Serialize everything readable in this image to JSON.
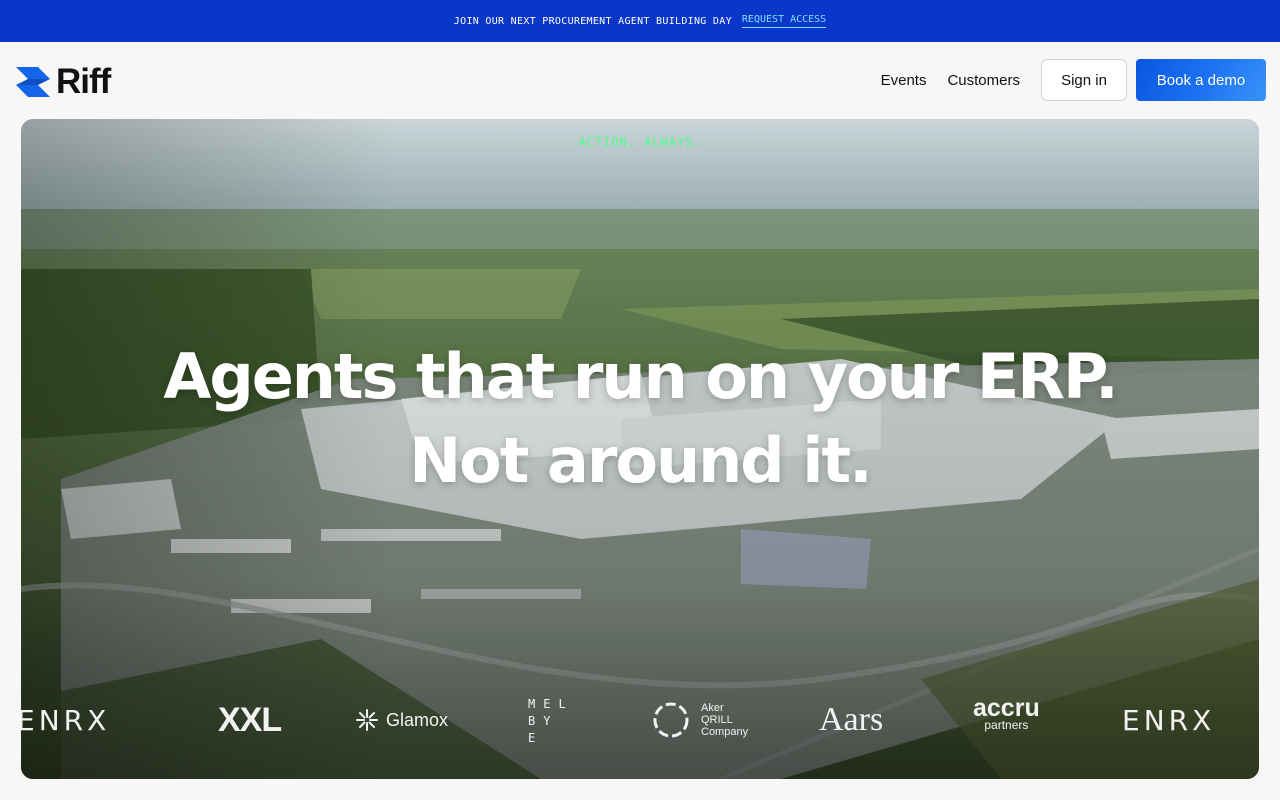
{
  "announcement": {
    "text": "JOIN OUR NEXT PROCUREMENT AGENT BUILDING DAY",
    "link_label": "REQUEST ACCESS"
  },
  "brand": {
    "name": "Riff",
    "logo_icon": "riff-logo-icon",
    "accent_color": "#1565e8"
  },
  "nav": {
    "links": [
      "Events",
      "Customers"
    ],
    "signin_label": "Sign in",
    "demo_label": "Book a demo"
  },
  "hero": {
    "tagline": "ACTION. ALWAYS.",
    "headline_line1": "Agents that run on your ERP.",
    "headline_line2": "Not around it.",
    "tagline_color": "#4dff8a"
  },
  "clients": {
    "enrx": "ENRX",
    "xxl": "XXL",
    "glamox": "Glamox",
    "melbye_lines": [
      "MEL",
      "BY",
      "E"
    ],
    "aker_lines": [
      "Aker",
      "QRILL",
      "Company"
    ],
    "aars": "Aars",
    "accru": "accru",
    "accru_sub": "partners"
  }
}
